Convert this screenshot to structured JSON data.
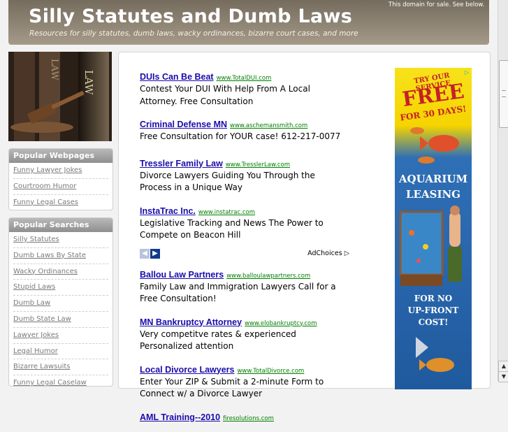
{
  "header": {
    "title": "Silly Statutes and Dumb Laws",
    "tagline": "Resources for silly statutes, dumb laws, wacky ordinances, bizarre court cases, and more",
    "sale_note": "This domain for sale. See below."
  },
  "sidebar": {
    "law_image_text": "LAW",
    "popular_webpages": {
      "title": "Popular Webpages",
      "items": [
        "Funny Lawyer Jokes",
        "Courtroom Humor",
        "Funny Legal Cases"
      ]
    },
    "popular_searches": {
      "title": "Popular Searches",
      "items": [
        "Silly Statutes",
        "Dumb Laws By State",
        "Wacky Ordinances",
        "Stupid Laws",
        "Dumb Law",
        "Dumb State Law",
        "Lawyer Jokes",
        "Legal Humor",
        "Bizarre Lawsuits",
        "Funny Legal Caselaw"
      ]
    }
  },
  "ads": [
    {
      "title": "DUIs Can Be Beat",
      "url": "www.TotalDUI.com",
      "desc": "Contest Your DUI With Help From A Local Attorney. Free Consultation"
    },
    {
      "title": "Criminal Defense MN",
      "url": "www.aschemansmith.com",
      "desc": "Free Consultation for YOUR case! 612-217-0077"
    },
    {
      "title": "Tressler Family Law",
      "url": "www.TresslerLaw.com",
      "desc": "Divorce Lawyers Guiding You Through the Process in a Unique Way"
    },
    {
      "title": "InstaTrac Inc.",
      "url": "www.instatrac.com",
      "desc": "Legislative Tracking and News The Power to Compete on Beacon Hill"
    }
  ],
  "ads2": [
    {
      "title": "Ballou Law Partners",
      "url": "www.balloulawpartners.com",
      "desc": "Family Law and Immigration Lawyers Call for a Free Consultation!"
    },
    {
      "title": "MN Bankruptcy Attorney",
      "url": "www.elobankruptcy.com",
      "desc": "Very competitve rates & experienced Personalized attention"
    },
    {
      "title": "Local Divorce Lawyers",
      "url": "www.TotalDivorce.com",
      "desc": "Enter Your ZIP & Submit a 2-minute Form to Connect w/ a Divorce Lawyer"
    },
    {
      "title": "AML Training--2010",
      "url": "firesolutions.com",
      "desc": ""
    }
  ],
  "adchoices": "AdChoices",
  "banner": {
    "try": "TRY OUR SERVICE",
    "free": "FREE",
    "days": "FOR 30 DAYS!",
    "aquarium": "AQUARIUM",
    "leasing": "LEASING",
    "no_upfront_1": "FOR NO",
    "no_upfront_2": "UP-FRONT",
    "no_upfront_3": "COST!"
  },
  "colors": {
    "ad_title": "#1a0dab",
    "ad_url": "#008000",
    "header_bg": "#8a7f6e"
  }
}
